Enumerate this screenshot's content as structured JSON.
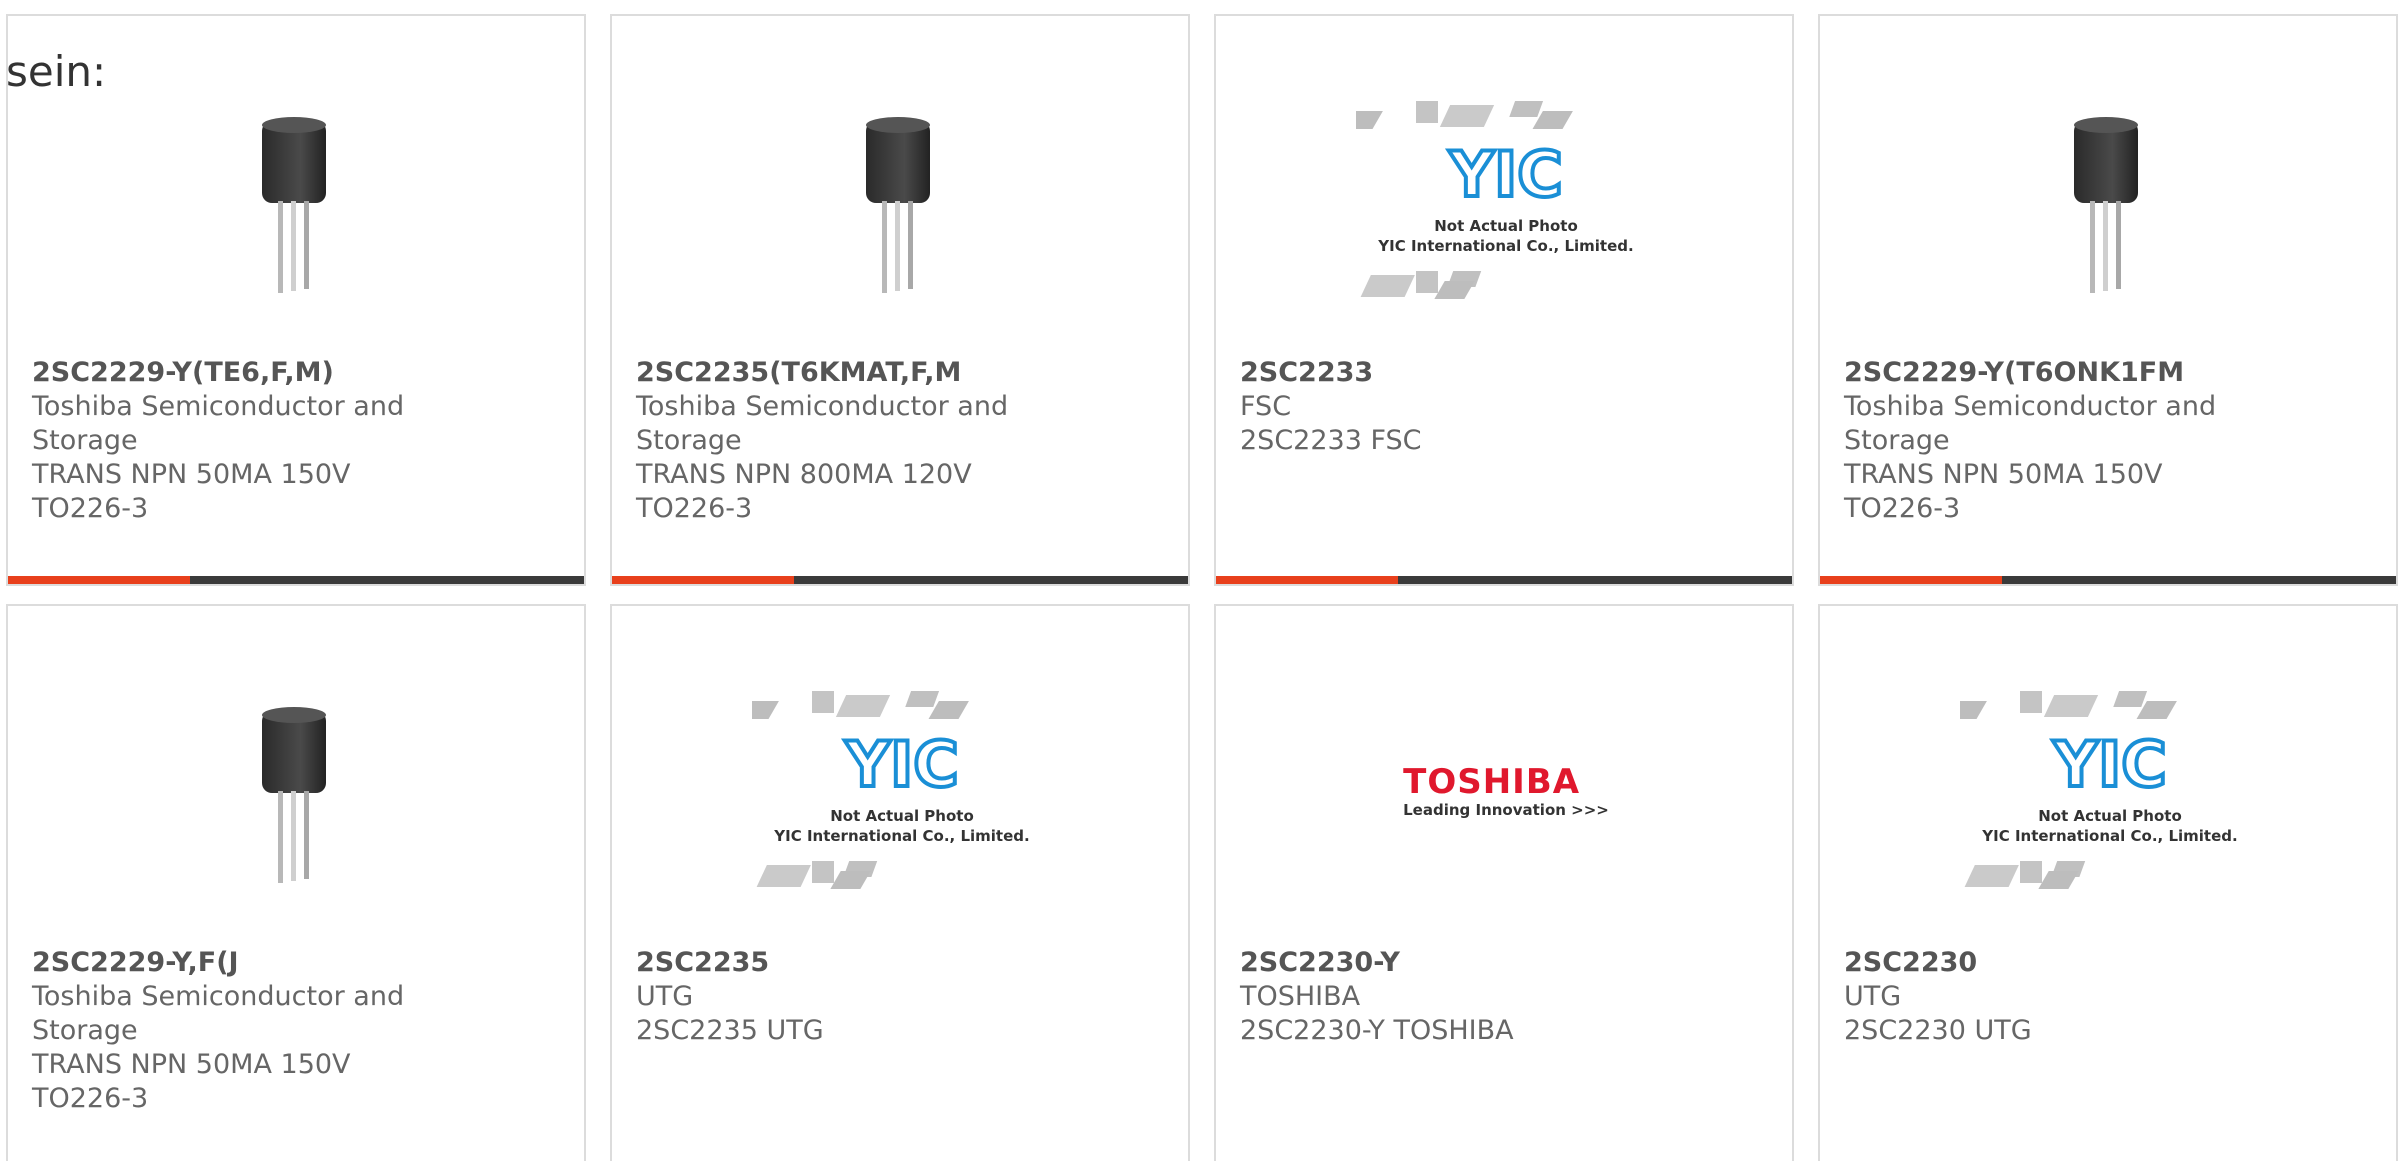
{
  "heading": "sein:",
  "colors": {
    "accent": "#e8401c",
    "bar": "#3a3a3a",
    "border": "#dcdcdc",
    "text": "#666666",
    "toshiba_red": "#e0182d",
    "yic_blue": "#1a8fd6"
  },
  "yic": {
    "logo_text": "YIC",
    "line1": "Not Actual Photo",
    "line2": "YIC International Co., Limited."
  },
  "toshiba": {
    "wordmark": "TOSHIBA",
    "tagline": "Leading Innovation >>>"
  },
  "products": [
    {
      "part": "2SC2229-Y(TE6,F,M)",
      "manufacturer": "Toshiba Semiconductor and Storage",
      "description": "TRANS NPN 50MA 150V TO226-3",
      "image": "transistor-photo"
    },
    {
      "part": "2SC2235(T6KMAT,F,M",
      "manufacturer": "Toshiba Semiconductor and Storage",
      "description": "TRANS NPN 800MA 120V TO226-3",
      "image": "transistor-photo"
    },
    {
      "part": "2SC2233",
      "manufacturer": "FSC",
      "description": "2SC2233 FSC",
      "image": "yic-placeholder"
    },
    {
      "part": "2SC2229-Y(T6ONK1FM",
      "manufacturer": "Toshiba Semiconductor and Storage",
      "description": "TRANS NPN 50MA 150V TO226-3",
      "image": "transistor-photo"
    },
    {
      "part": "2SC2229-Y,F(J",
      "manufacturer": "Toshiba Semiconductor and Storage",
      "description": "TRANS NPN 50MA 150V TO226-3",
      "image": "transistor-photo"
    },
    {
      "part": "2SC2235",
      "manufacturer": "UTG",
      "description": "2SC2235 UTG",
      "image": "yic-placeholder"
    },
    {
      "part": "2SC2230-Y",
      "manufacturer": "TOSHIBA",
      "description": "2SC2230-Y TOSHIBA",
      "image": "toshiba-logo"
    },
    {
      "part": "2SC2230",
      "manufacturer": "UTG",
      "description": "2SC2230 UTG",
      "image": "yic-placeholder"
    }
  ]
}
